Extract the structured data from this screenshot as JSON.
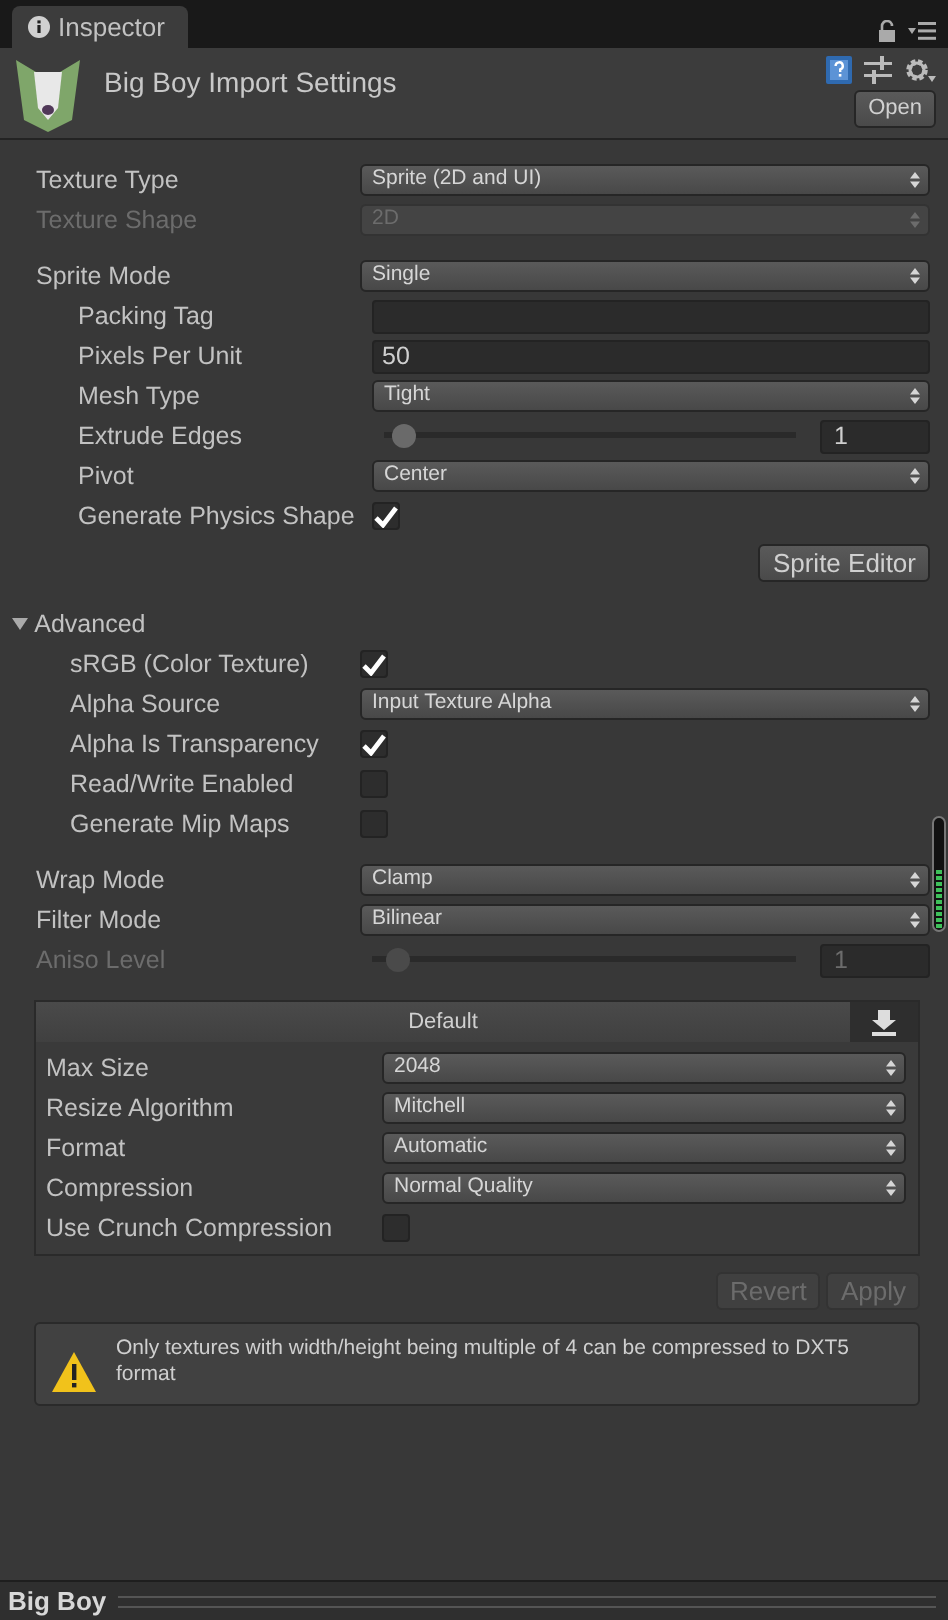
{
  "tab": {
    "title": "Inspector"
  },
  "header": {
    "title": "Big Boy Import Settings",
    "open_button": "Open"
  },
  "groups": [
    [
      {
        "kind": "dropdown",
        "label": "Texture Type",
        "value": "Sprite (2D and UI)",
        "disabled": false
      },
      {
        "kind": "dropdown",
        "label": "Texture Shape",
        "value": "2D",
        "disabled": true
      }
    ],
    [
      {
        "kind": "dropdown",
        "label": "Sprite Mode",
        "value": "Single",
        "disabled": false,
        "children": [
          {
            "kind": "text",
            "label": "Packing Tag",
            "disabled": false
          },
          {
            "kind": "text",
            "label": "Pixels Per Unit",
            "value": "50",
            "disabled": false
          },
          {
            "kind": "dropdown",
            "label": "Mesh Type",
            "value": "Tight",
            "disabled": false
          },
          {
            "kind": "slider",
            "label": "Extrude Edges",
            "level": 0.05,
            "value": "1",
            "disabled": false
          },
          {
            "kind": "dropdown",
            "label": "Pivot",
            "value": "Center",
            "disabled": false
          },
          {
            "kind": "checkbox",
            "label": "Generate Physics Shape",
            "checked": true,
            "disabled": false
          }
        ]
      },
      {
        "kind": "button",
        "label": "Sprite Editor",
        "disabled": false
      }
    ],
    [
      {
        "kind": "foldout",
        "label": "Advanced",
        "expanded": true,
        "disabled": false,
        "children": [
          {
            "kind": "checkbox",
            "label": "sRGB (Color Texture)",
            "checked": true,
            "disabled": false
          },
          {
            "kind": "dropdown",
            "label": "Alpha Source",
            "value": "Input Texture Alpha",
            "disabled": false
          },
          {
            "kind": "checkbox",
            "label": "Alpha Is Transparency",
            "checked": true,
            "disabled": false
          },
          {
            "kind": "checkbox",
            "label": "Read/Write Enabled",
            "checked": false,
            "disabled": false
          },
          {
            "kind": "checkbox",
            "label": "Generate Mip Maps",
            "checked": false,
            "disabled": false
          }
        ]
      }
    ],
    [
      {
        "kind": "dropdown",
        "label": "Wrap Mode",
        "value": "Clamp",
        "disabled": false
      },
      {
        "kind": "dropdown",
        "label": "Filter Mode",
        "value": "Bilinear",
        "disabled": false
      },
      {
        "kind": "slider",
        "label": "Aniso Level",
        "level": 0.06,
        "value": "1",
        "disabled": true
      }
    ]
  ],
  "platform": {
    "tab": "Default",
    "fields": [
      {
        "kind": "dropdown",
        "label": "Max Size",
        "value": "2048",
        "disabled": false
      },
      {
        "kind": "dropdown",
        "label": "Resize Algorithm",
        "value": "Mitchell",
        "disabled": false
      },
      {
        "kind": "dropdown",
        "label": "Format",
        "value": "Automatic",
        "disabled": false
      },
      {
        "kind": "dropdown",
        "label": "Compression",
        "value": "Normal Quality",
        "disabled": false
      },
      {
        "kind": "checkbox",
        "label": "Use Crunch Compression",
        "checked": false,
        "disabled": false
      }
    ]
  },
  "actions": [
    {
      "label": "Revert",
      "disabled": true
    },
    {
      "label": "Apply",
      "disabled": true
    }
  ],
  "warning": "Only textures with width/height being multiple of 4 can be compressed to DXT5 format",
  "footer": {
    "title": "Big Boy"
  }
}
